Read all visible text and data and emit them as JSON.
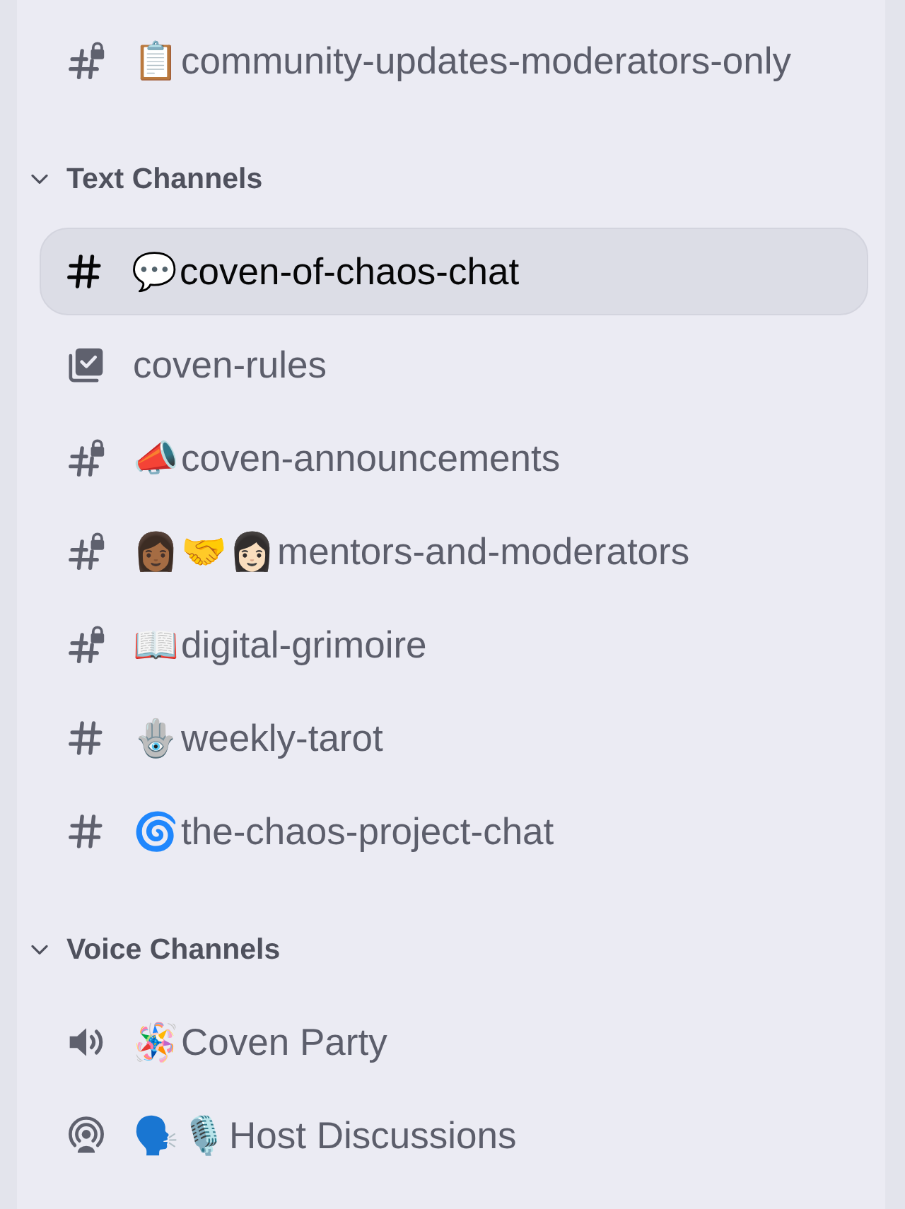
{
  "channels": [
    {
      "kind": "locked",
      "emoji": [
        "📋"
      ],
      "name": "community-updates-moderators-only",
      "selected": false
    }
  ],
  "categories": [
    {
      "title": "Text Channels",
      "expanded": true,
      "channels": [
        {
          "kind": "text",
          "emoji": [
            "💬"
          ],
          "name": "coven-of-chaos-chat",
          "selected": true
        },
        {
          "kind": "rules",
          "name": "coven-rules",
          "selected": false
        },
        {
          "kind": "locked",
          "emoji": [
            "📣"
          ],
          "name": "coven-announcements",
          "selected": false
        },
        {
          "kind": "locked",
          "emoji": [
            "👩🏾",
            "🤝",
            "👩🏻"
          ],
          "name": "mentors-and-moderators",
          "selected": false
        },
        {
          "kind": "locked",
          "emoji": [
            "📖"
          ],
          "name": "digital-grimoire",
          "selected": false
        },
        {
          "kind": "text",
          "emoji": [
            "🪬"
          ],
          "name": "weekly-tarot",
          "selected": false
        },
        {
          "kind": "text",
          "emoji": [
            "🌀"
          ],
          "name": "the-chaos-project-chat",
          "selected": false
        }
      ]
    },
    {
      "title": "Voice Channels",
      "expanded": true,
      "channels": [
        {
          "kind": "voice",
          "emoji": [
            "🪅"
          ],
          "name": "Coven Party",
          "selected": false
        },
        {
          "kind": "stage",
          "emoji": [
            "🗣️",
            "🎙️"
          ],
          "name": "Host Discussions",
          "selected": false
        }
      ]
    }
  ]
}
